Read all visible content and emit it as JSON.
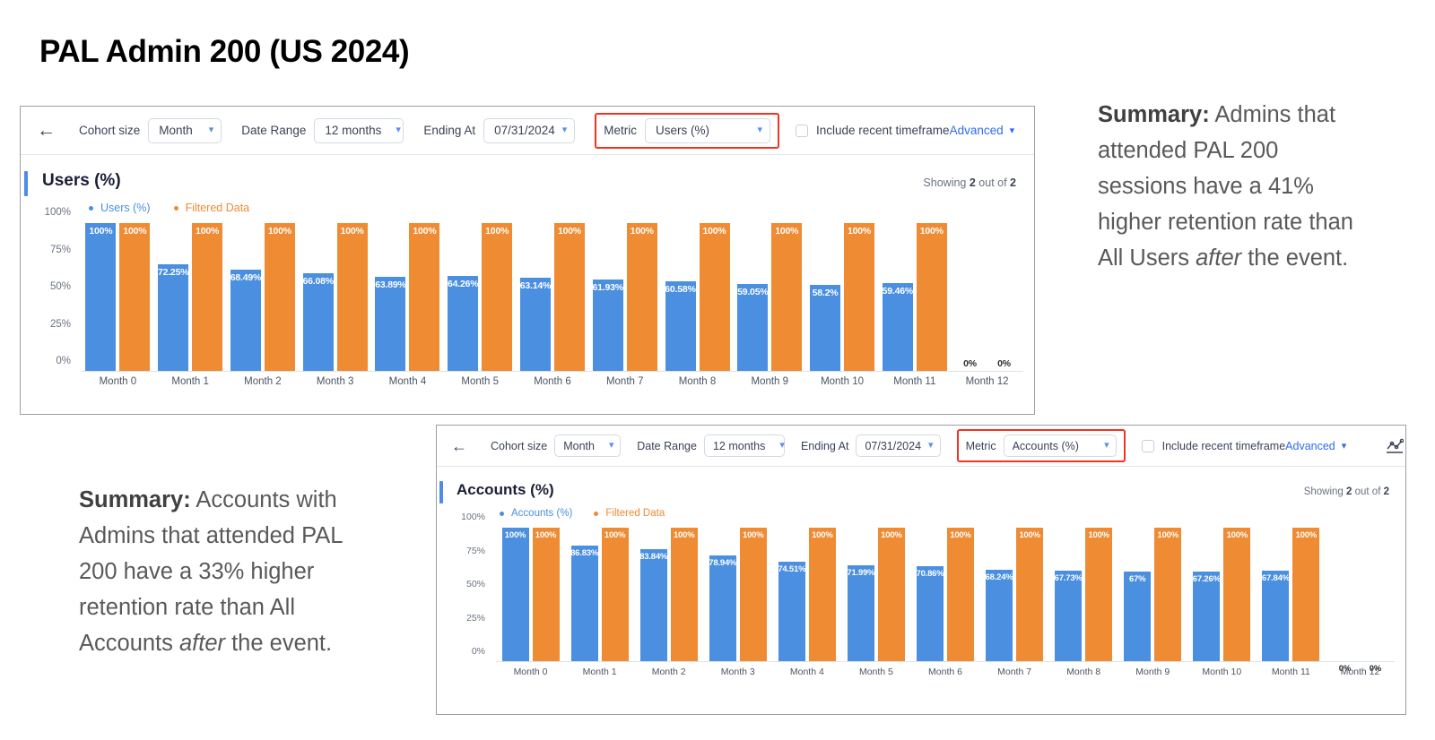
{
  "slide": {
    "title": "PAL Admin 200 (US 2024)"
  },
  "summary_top": {
    "lead": "Summary:",
    "text_1": " Admins that attended PAL 200 sessions have a 41% higher retention rate than All Users ",
    "emphasis": "after",
    "text_2": " the event."
  },
  "summary_bottom": {
    "lead": "Summary:",
    "text_1": " Accounts with Admins that attended PAL 200 have a 33% higher retention rate than All Accounts ",
    "emphasis": "after",
    "text_2": " the event."
  },
  "users_panel": {
    "toolbar": {
      "back_icon": "back-arrow-icon",
      "cohort_size_label": "Cohort size",
      "cohort_size_value": "Month",
      "date_range_label": "Date Range",
      "date_range_value": "12 months",
      "ending_at_label": "Ending At",
      "ending_at_value": "07/31/2024",
      "metric_label": "Metric",
      "metric_value": "Users (%)",
      "include_recent_label": "Include recent timeframe",
      "advanced_label": "Advanced",
      "line_chart_icon": "line-chart-icon",
      "bar_chart_icon": "bar-chart-icon"
    },
    "header": {
      "title": "Users (%)",
      "showing_prefix": "Showing ",
      "showing_count": "2",
      "showing_middle": " out of ",
      "showing_total": "2"
    },
    "legend": [
      {
        "label": "Users (%)",
        "color": "#4a8fe0"
      },
      {
        "label": "Filtered Data",
        "color": "#ef8b33"
      }
    ]
  },
  "accounts_panel": {
    "toolbar": {
      "back_icon": "back-arrow-icon",
      "cohort_size_label": "Cohort size",
      "cohort_size_value": "Month",
      "date_range_label": "Date Range",
      "date_range_value": "12 months",
      "ending_at_label": "Ending At",
      "ending_at_value": "07/31/2024",
      "metric_label": "Metric",
      "metric_value": "Accounts (%)",
      "include_recent_label": "Include recent timeframe",
      "advanced_label": "Advanced",
      "line_chart_icon": "line-chart-icon",
      "bar_chart_icon": "bar-chart-icon"
    },
    "header": {
      "title": "Accounts (%)",
      "showing_prefix": "Showing ",
      "showing_count": "2",
      "showing_middle": " out of ",
      "showing_total": "2"
    },
    "legend": [
      {
        "label": "Accounts (%)",
        "color": "#4a8fe0"
      },
      {
        "label": "Filtered Data",
        "color": "#ef8b33"
      }
    ]
  },
  "chart_data": [
    {
      "type": "bar",
      "title": "Users (%)",
      "xlabel": "",
      "ylabel": "",
      "ylim": [
        0,
        100
      ],
      "yticks": [
        "0%",
        "25%",
        "50%",
        "75%",
        "100%"
      ],
      "grid": false,
      "legend_position": "top-left",
      "categories": [
        "Month 0",
        "Month 1",
        "Month 2",
        "Month 3",
        "Month 4",
        "Month 5",
        "Month 6",
        "Month 7",
        "Month 8",
        "Month 9",
        "Month 10",
        "Month 11",
        "Month 12"
      ],
      "series": [
        {
          "name": "Users (%)",
          "color": "#4a8fe0",
          "values": [
            100,
            72.25,
            68.49,
            66.08,
            63.89,
            64.26,
            63.14,
            61.93,
            60.58,
            59.05,
            58.2,
            59.46,
            0
          ],
          "labels": [
            "100%",
            "72.25%",
            "68.49%",
            "66.08%",
            "63.89%",
            "64.26%",
            "63.14%",
            "61.93%",
            "60.58%",
            "59.05%",
            "58.2%",
            "59.46%",
            "0%"
          ]
        },
        {
          "name": "Filtered Data",
          "color": "#ef8b33",
          "values": [
            100,
            100,
            100,
            100,
            100,
            100,
            100,
            100,
            100,
            100,
            100,
            100,
            0
          ],
          "labels": [
            "100%",
            "100%",
            "100%",
            "100%",
            "100%",
            "100%",
            "100%",
            "100%",
            "100%",
            "100%",
            "100%",
            "100%",
            "0%"
          ]
        }
      ]
    },
    {
      "type": "bar",
      "title": "Accounts (%)",
      "xlabel": "",
      "ylabel": "",
      "ylim": [
        0,
        100
      ],
      "yticks": [
        "0%",
        "25%",
        "50%",
        "75%",
        "100%"
      ],
      "grid": false,
      "legend_position": "top-left",
      "categories": [
        "Month 0",
        "Month 1",
        "Month 2",
        "Month 3",
        "Month 4",
        "Month 5",
        "Month 6",
        "Month 7",
        "Month 8",
        "Month 9",
        "Month 10",
        "Month 11",
        "Month 12"
      ],
      "series": [
        {
          "name": "Accounts (%)",
          "color": "#4a8fe0",
          "values": [
            100,
            86.83,
            83.84,
            78.94,
            74.51,
            71.99,
            70.86,
            68.24,
            67.73,
            67,
            67.26,
            67.84,
            0
          ],
          "labels": [
            "100%",
            "86.83%",
            "83.84%",
            "78.94%",
            "74.51%",
            "71.99%",
            "70.86%",
            "68.24%",
            "67.73%",
            "67%",
            "67.26%",
            "67.84%",
            "0%"
          ]
        },
        {
          "name": "Filtered Data",
          "color": "#ef8b33",
          "values": [
            100,
            100,
            100,
            100,
            100,
            100,
            100,
            100,
            100,
            100,
            100,
            100,
            0
          ],
          "labels": [
            "100%",
            "100%",
            "100%",
            "100%",
            "100%",
            "100%",
            "100%",
            "100%",
            "100%",
            "100%",
            "100%",
            "100%",
            "0%"
          ]
        }
      ]
    }
  ],
  "colors": {
    "blue_series": "#4a8fe0",
    "orange_series": "#ef8b33",
    "accent_link": "#2f6bf0",
    "highlight_box": "#f4321f"
  }
}
